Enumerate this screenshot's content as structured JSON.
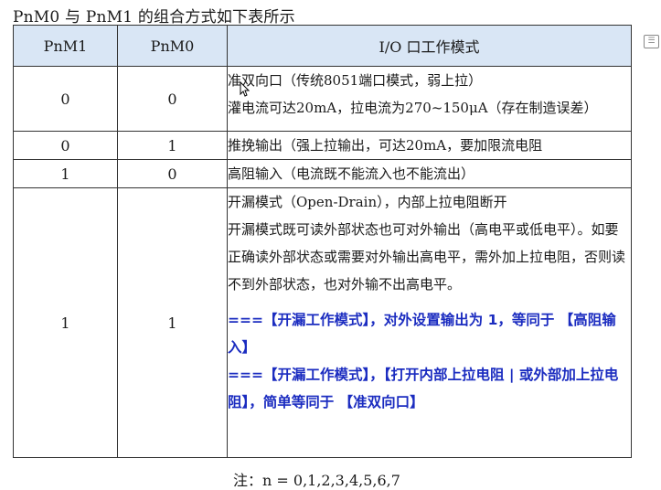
{
  "title": "PnM0 与 PnM1 的组合方式如下表所示",
  "table": {
    "headers": [
      "PnM1",
      "PnM0",
      "I/O 口工作模式"
    ],
    "rows": [
      {
        "pnm1": "0",
        "pnm0": "0",
        "lines": [
          "准双向口（传统8051端口模式，弱上拉）",
          "灌电流可达20mA，拉电流为270~150μA（存在制造误差）"
        ]
      },
      {
        "pnm1": "0",
        "pnm0": "1",
        "lines": [
          "推挽输出（强上拉输出，可达20mA，要加限流电阻"
        ]
      },
      {
        "pnm1": "1",
        "pnm0": "0",
        "lines": [
          "高阻输入（电流既不能流入也不能流出）"
        ]
      },
      {
        "pnm1": "1",
        "pnm0": "1",
        "lines": [
          "开漏模式（Open-Drain），内部上拉电阻断开",
          "开漏模式既可读外部状态也可对外输出（高电平或低电平）。如要正确读外部状态或需要对外输出高电平，需外加上拉电阻，否则读不到外部状态，也对外输不出高电平。"
        ],
        "notes": [
          "===【开漏工作模式】，对外设置输出为 1，等同于 【高阻输入】",
          "===【开漏工作模式】，【打开内部上拉电阻 | 或外部加上拉电阻】，简单等同于 【准双向口】"
        ]
      }
    ]
  },
  "footnote": "注：n = 0,1,2,3,4,5,6,7",
  "icons": {
    "side": "edit-note-icon",
    "pointer": "mouse-cursor-icon"
  },
  "colors": {
    "header_bg": "#d9e6f5",
    "note_text": "#1b2cc0"
  }
}
